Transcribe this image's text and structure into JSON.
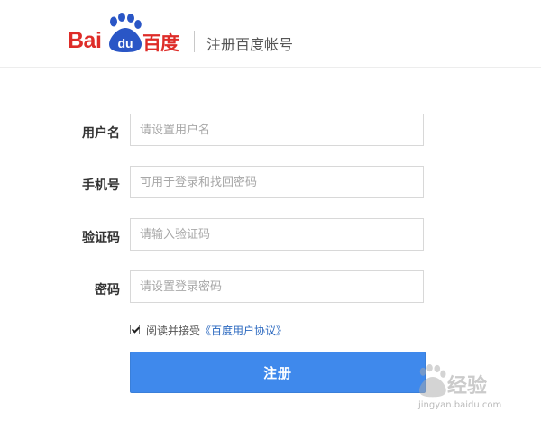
{
  "header": {
    "logo_text": "Baidu百度",
    "logo_bai": "Bai",
    "logo_du": "du",
    "logo_cn": "百度",
    "title": "注册百度帐号"
  },
  "form": {
    "fields": [
      {
        "label": "用户名",
        "placeholder": "请设置用户名",
        "value": ""
      },
      {
        "label": "手机号",
        "placeholder": "可用于登录和找回密码",
        "value": ""
      },
      {
        "label": "验证码",
        "placeholder": "请输入验证码",
        "value": ""
      },
      {
        "label": "密码",
        "placeholder": "请设置登录密码",
        "value": ""
      }
    ],
    "agreement": {
      "checked": true,
      "text": "阅读并接受",
      "link": "《百度用户协议》"
    },
    "submit_label": "注册"
  },
  "watermark": {
    "text": "经验",
    "url": "jingyan.baidu.com"
  },
  "colors": {
    "brand_red": "#de2c28",
    "brand_blue": "#2a56c6",
    "button_blue": "#3f89ec",
    "link_blue": "#2d6ac0"
  }
}
